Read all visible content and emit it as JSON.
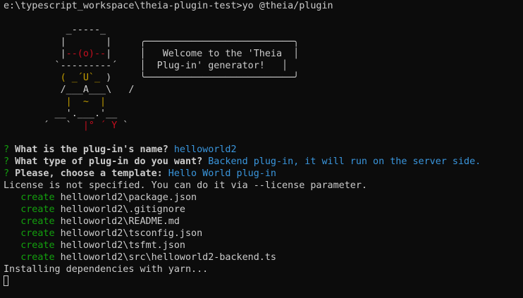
{
  "terminal": {
    "prompt_path": "e:\\typescript_workspace\\theia-plugin-test>",
    "command": "yo @theia/plugin",
    "art": {
      "l1": "           _-----_",
      "l2": "          |       |     ╭──────────────────────────╮",
      "l3a": "          |",
      "l3b": "--(o)--",
      "l3c": "|     │   Welcome to the 'Theia  │",
      "l4": "         `---------´    │  Plug-in' generator!   │",
      "l5a": "          ( ",
      "l5b": "_´U`_",
      "l5c": " )     ╰──────────────────────────╯",
      "l6a": "          /___A___\\   /",
      "l7a": "           |  ",
      "l7b": "~",
      "l7c": "  |",
      "l8": "         __'.___.'__",
      "l9a": "       ´   `  ",
      "l9b": "|° ´ Y",
      "l9c": " `"
    },
    "q1_mark": "?",
    "q1_text": " What is the plug-in's name? ",
    "q1_answer": "helloworld2",
    "q2_mark": "?",
    "q2_text": " What type of plug-in do you want? ",
    "q2_answer": "Backend plug-in, it will run on the server side.",
    "q3_mark": "?",
    "q3_text": " Please, choose a template: ",
    "q3_answer": "Hello World plug-in",
    "license_msg": "License is not specified. You can do it via --license parameter.",
    "create_label": "create",
    "created_files": [
      "helloworld2\\package.json",
      "helloworld2\\.gitignore",
      "helloworld2\\README.md",
      "helloworld2\\tsconfig.json",
      "helloworld2\\tsfmt.json",
      "helloworld2\\src\\helloworld2-backend.ts"
    ],
    "installing_msg": "Installing dependencies with yarn..."
  }
}
